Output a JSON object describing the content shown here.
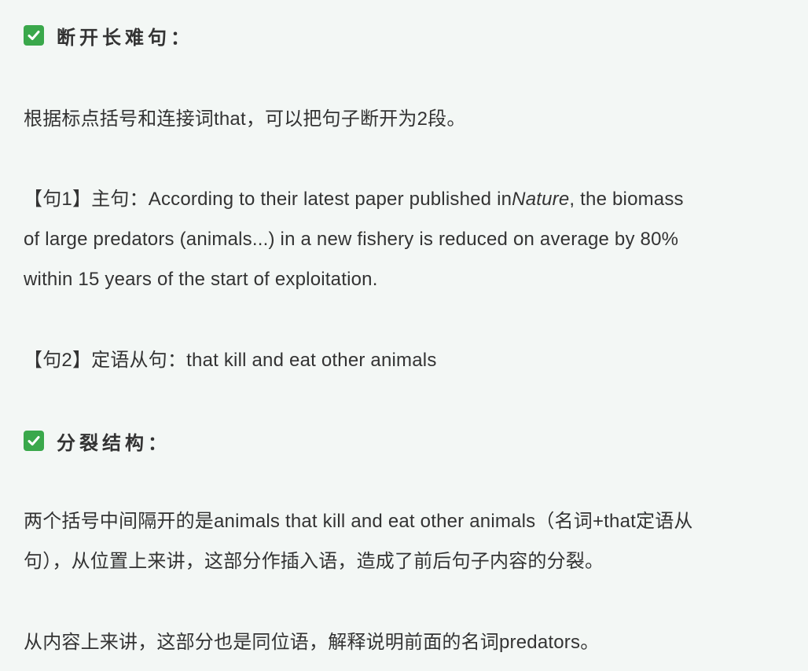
{
  "heading1": {
    "text": "断开长难句：",
    "icon": "check-mark-icon",
    "icon_color": "#3aa84b"
  },
  "para1": "根据标点括号和连接词that，可以把句子断开为2段。",
  "sentence1": {
    "line1_prefix": "【句1】主句：According to their latest paper published in",
    "line1_italic": "Nature",
    "line1_suffix": ", the biomass",
    "line2": "of large predators (animals...) in a new fishery is reduced on average by 80%",
    "line3": "within 15 years of the start of exploitation."
  },
  "sentence2": "【句2】定语从句：that kill and eat other animals",
  "heading2": {
    "text": "分裂结构：",
    "icon": "check-mark-icon",
    "icon_color": "#3aa84b"
  },
  "para2": {
    "line1": "两个括号中间隔开的是animals that kill and eat other animals（名词+that定语从",
    "line2": "句），从位置上来讲，这部分作插入语，造成了前后句子内容的分裂。"
  },
  "para3": "从内容上来讲，这部分也是同位语，解释说明前面的名词predators。"
}
